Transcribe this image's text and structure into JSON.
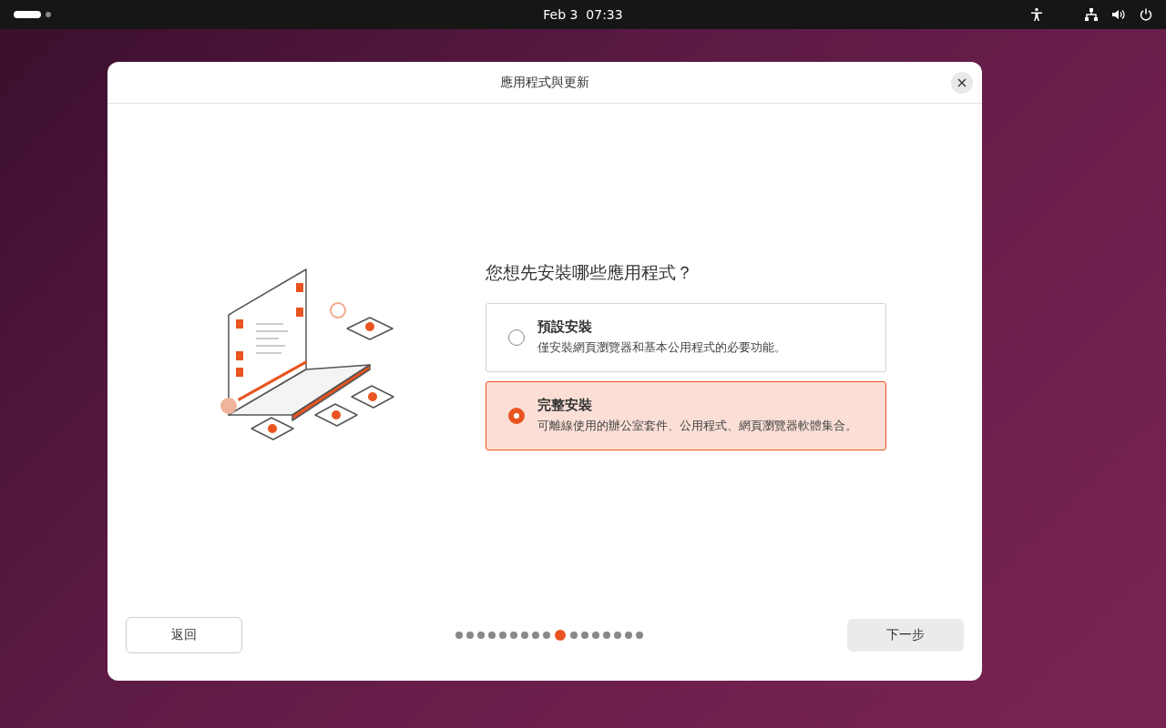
{
  "top_bar": {
    "clock": "Feb 3  07:33"
  },
  "dialog": {
    "title": "應用程式與更新"
  },
  "question": "您想先安裝哪些應用程式？",
  "options": [
    {
      "title": "預設安裝",
      "description": "僅安裝網頁瀏覽器和基本公用程式的必要功能。",
      "selected": false
    },
    {
      "title": "完整安裝",
      "description": "可離線使用的辦公室套件、公用程式、網頁瀏覽器軟體集合。",
      "selected": true
    }
  ],
  "steps": [
    {
      "selected": false
    },
    {
      "selected": false
    },
    {
      "selected": false
    },
    {
      "selected": false
    },
    {
      "selected": false
    },
    {
      "selected": false
    },
    {
      "selected": false
    },
    {
      "selected": false
    },
    {
      "selected": false
    },
    {
      "selected": true
    },
    {
      "selected": false
    },
    {
      "selected": false
    },
    {
      "selected": false
    },
    {
      "selected": false
    },
    {
      "selected": false
    },
    {
      "selected": false
    },
    {
      "selected": false
    }
  ],
  "buttons": {
    "back": "返回",
    "next": "下一步"
  }
}
